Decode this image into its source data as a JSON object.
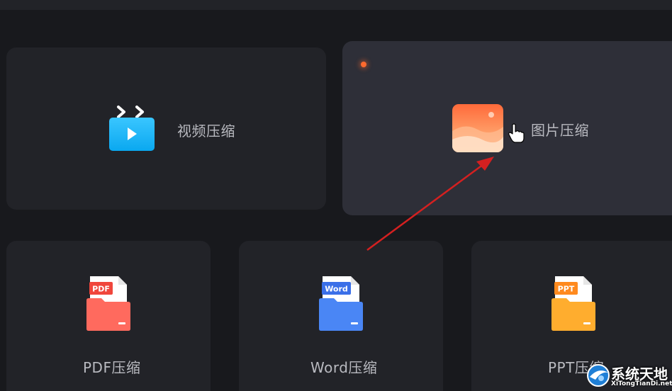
{
  "cards": {
    "video": {
      "label": "视频压缩",
      "icon": "video-clapper-icon"
    },
    "image": {
      "label": "图片压缩",
      "icon": "image-landscape-icon",
      "state": "hovered"
    },
    "pdf": {
      "label": "PDF压缩",
      "icon": "pdf-folder-icon",
      "badge": "PDF"
    },
    "word": {
      "label": "Word压缩",
      "icon": "word-folder-icon",
      "badge": "Word"
    },
    "ppt": {
      "label": "PPT压缩",
      "icon": "ppt-folder-icon",
      "badge": "PPT"
    }
  },
  "annotation": {
    "type": "red-arrow",
    "color": "#d42020"
  },
  "watermark": {
    "title": "系统天地",
    "subtitle": "XiTongTianDi.net"
  },
  "colors": {
    "background": "#18191d",
    "card": "#222328",
    "card_hover": "#2e2f38",
    "label": "#b9bac0",
    "accent_dot": "#ff6a2e"
  }
}
